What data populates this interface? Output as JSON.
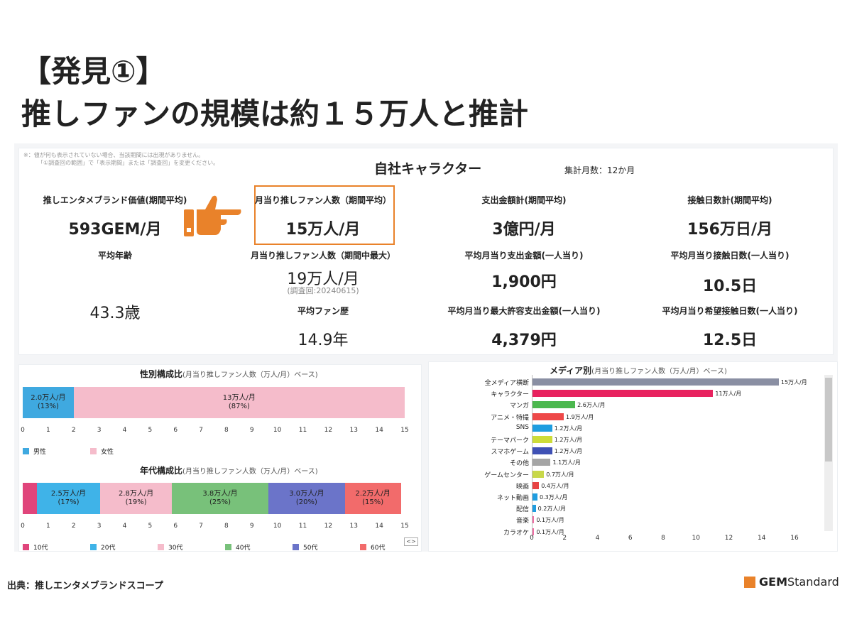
{
  "heading": {
    "line1": "【発見①】",
    "line2": "推しファンの規模は約１５万人と推計"
  },
  "kpi": {
    "note_line1": "※：値が何も表示されていない場合、当該期間には出現がありません。",
    "note_line2": "「①調査回の範囲」で「表示期間」または「調査回」を変更ください。",
    "title": "自社キャラクター",
    "months": "集計月数：12か月",
    "items": [
      {
        "label": "推しエンタメブランド価値(期間平均)",
        "value": "593GEM/月"
      },
      {
        "label": "月当り推しファン人数（期間平均）",
        "value": "15万人/月"
      },
      {
        "label": "支出金額計(期間平均)",
        "value": "3億円/月"
      },
      {
        "label": "接触日数計(期間平均)",
        "value": "156万日/月"
      },
      {
        "label": "平均年齢",
        "value": "43.3歳"
      },
      {
        "label": "月当り推しファン人数（期間中最大）",
        "value": "19万人/月",
        "sub": "(調査回:20240615)"
      },
      {
        "label": "平均月当り支出金額(一人当り)",
        "value": "1,900円"
      },
      {
        "label": "平均月当り接触日数(一人当り)",
        "value": "10.5日"
      },
      {
        "label": "平均ファン歴",
        "value": "14.9年"
      },
      {
        "label": "平均月当り最大許容支出金額(一人当り)",
        "value": "4,379円"
      },
      {
        "label": "平均月当り希望接触日数(一人当り)",
        "value": "12.5日"
      }
    ]
  },
  "gender_chart": {
    "title": "性別構成比",
    "subtitle": "(月当り推しファン人数（万人/月）ベース)"
  },
  "age_chart": {
    "title": "年代構成比",
    "subtitle": "(月当り推しファン人数（万人/月）ベース)"
  },
  "media_chart": {
    "title": "メディア別",
    "subtitle": "(月当り推しファン人数（万人/月）ベース)"
  },
  "chart_data": [
    {
      "type": "bar",
      "orientation": "horizontal-stacked",
      "title": "性別構成比",
      "xlim": [
        0,
        15
      ],
      "ticks": [
        0,
        1,
        2,
        3,
        4,
        5,
        6,
        7,
        8,
        9,
        10,
        11,
        12,
        13,
        14,
        15
      ],
      "series": [
        {
          "name": "男性",
          "value": 2.0,
          "label": "2.0万人/月",
          "pct": "(13%)",
          "color": "#3fa9e0"
        },
        {
          "name": "女性",
          "value": 13.0,
          "label": "13万人/月",
          "pct": "(87%)",
          "color": "#f5bccb"
        }
      ]
    },
    {
      "type": "bar",
      "orientation": "horizontal-stacked",
      "title": "年代構成比",
      "xlim": [
        0,
        15
      ],
      "ticks": [
        0,
        1,
        2,
        3,
        4,
        5,
        6,
        7,
        8,
        9,
        10,
        11,
        12,
        13,
        14,
        15
      ],
      "series": [
        {
          "name": "10代",
          "value": 0.55,
          "label": "",
          "pct": "",
          "color": "#e0457b"
        },
        {
          "name": "20代",
          "value": 2.5,
          "label": "2.5万人/月",
          "pct": "(17%)",
          "color": "#3fb3e8"
        },
        {
          "name": "30代",
          "value": 2.8,
          "label": "2.8万人/月",
          "pct": "(19%)",
          "color": "#f5bccb"
        },
        {
          "name": "40代",
          "value": 3.8,
          "label": "3.8万人/月",
          "pct": "(25%)",
          "color": "#78c17a"
        },
        {
          "name": "50代",
          "value": 3.0,
          "label": "3.0万人/月",
          "pct": "(20%)",
          "color": "#6b74c9"
        },
        {
          "name": "60代",
          "value": 2.2,
          "label": "2.2万人/月",
          "pct": "(15%)",
          "color": "#f26b6b"
        }
      ]
    },
    {
      "type": "bar",
      "orientation": "horizontal",
      "title": "メディア別",
      "xlim": [
        0,
        16
      ],
      "ticks": [
        0,
        2,
        4,
        6,
        8,
        10,
        12,
        14,
        16
      ],
      "categories": [
        "全メディア横断",
        "キャラクター",
        "マンガ",
        "アニメ・特撮",
        "SNS",
        "テーマパーク",
        "スマホゲーム",
        "その他",
        "ゲームセンター",
        "映画",
        "ネット動画",
        "配信",
        "音楽",
        "カラオケ"
      ],
      "values": [
        15,
        11,
        2.6,
        1.9,
        1.2,
        1.2,
        1.2,
        1.1,
        0.7,
        0.4,
        0.3,
        0.2,
        0.1,
        0.1
      ],
      "labels": [
        "15万人/月",
        "11万人/月",
        "2.6万人/月",
        "1.9万人/月",
        "1.2万人/月",
        "1.2万人/月",
        "1.2万人/月",
        "1.1万人/月",
        "0.7万人/月",
        "0.4万人/月",
        "0.3万人/月",
        "0.2万人/月",
        "0.1万人/月",
        "0.1万人/月"
      ],
      "colors": [
        "#8a8fa3",
        "#e8225f",
        "#4cb84f",
        "#ee4848",
        "#1f9de0",
        "#cddc39",
        "#3f51b5",
        "#a5a5a5",
        "#c8d84a",
        "#e84343",
        "#1f9de0",
        "#1f9de0",
        "#f06fa5",
        "#f06fa5"
      ]
    }
  ],
  "source": "出典：推しエンタメブランドスコープ",
  "logo": {
    "bold": "GEM",
    "rest": " Standard",
    "color": "#e9822a"
  }
}
